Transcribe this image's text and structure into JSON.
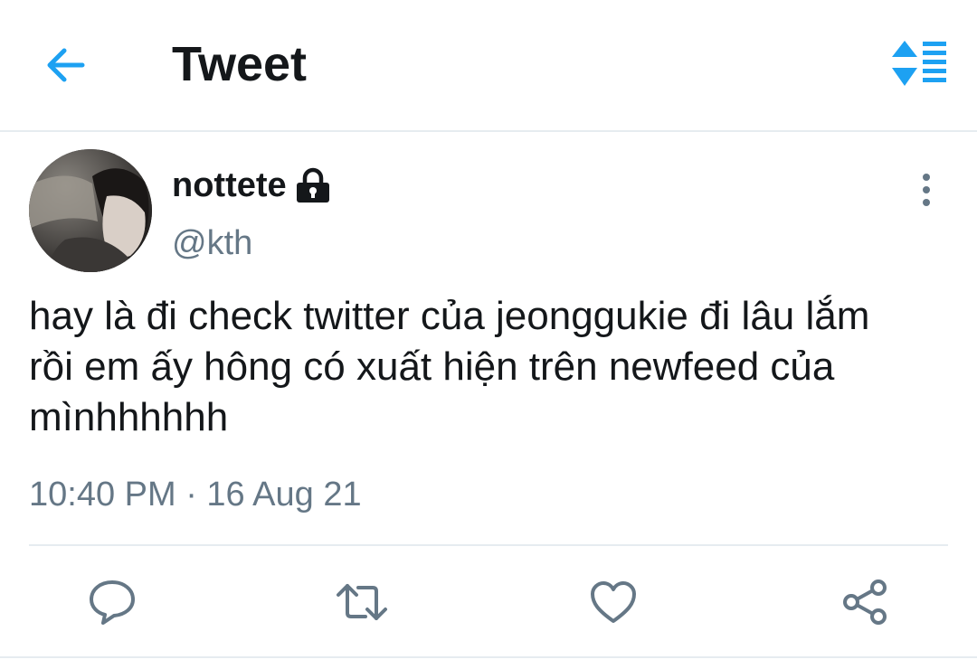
{
  "header": {
    "title": "Tweet",
    "back_icon": "arrow-left-icon",
    "sort_icon": "sort-lines-icon",
    "accent_color": "#1da1f2"
  },
  "tweet": {
    "author": {
      "display_name": "nottete",
      "handle": "@kth",
      "protected_icon": "lock-icon",
      "avatar_icon": "user-avatar"
    },
    "text": "hay là đi check twitter của jeonggukie đi lâu lắm\nrồi em ấy hông có xuất hiện trên newfeed của\nmìnhhhhhh",
    "timestamp": "10:40 PM · 16 Aug 21",
    "more_icon": "more-vertical-icon"
  },
  "actions": {
    "reply_icon": "reply-icon",
    "retweet_icon": "retweet-icon",
    "like_icon": "heart-icon",
    "share_icon": "share-icon",
    "icon_color": "#657786"
  }
}
